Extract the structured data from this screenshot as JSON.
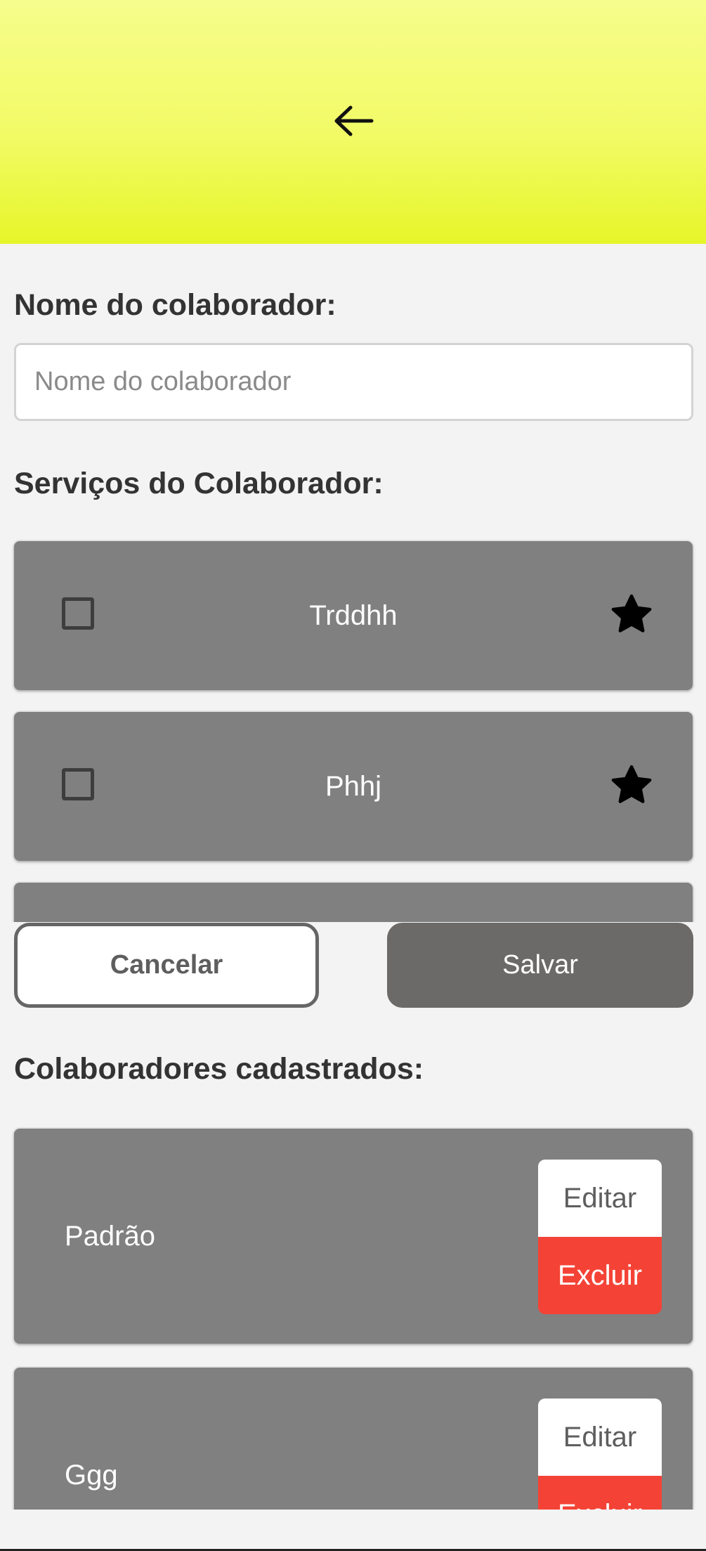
{
  "header": {
    "back_icon": "arrow-left-icon",
    "gradient": [
      "#f6fd8c",
      "#e6f529"
    ]
  },
  "form": {
    "name_label": "Nome do colaborador:",
    "name_placeholder": "Nome do colaborador",
    "name_value": "",
    "services_label": "Serviços do Colaborador:",
    "services": [
      {
        "name": "Trddhh",
        "checked": false,
        "star_icon": "star-icon"
      },
      {
        "name": "Phhj",
        "checked": false,
        "star_icon": "star-icon"
      },
      {
        "name": "",
        "checked": false,
        "star_icon": "star-icon"
      }
    ],
    "cancel_label": "Cancelar",
    "save_label": "Salvar"
  },
  "collaborators": {
    "title": "Colaboradores cadastrados:",
    "items": [
      {
        "name": "Padrão",
        "edit_label": "Editar",
        "delete_label": "Excluir"
      },
      {
        "name": "Ggg",
        "edit_label": "Editar",
        "delete_label": "Excluir"
      }
    ]
  },
  "colors": {
    "card": "#808080",
    "save_button": "#6b6a68",
    "delete_button": "#f44336",
    "background": "#f3f3f3"
  }
}
